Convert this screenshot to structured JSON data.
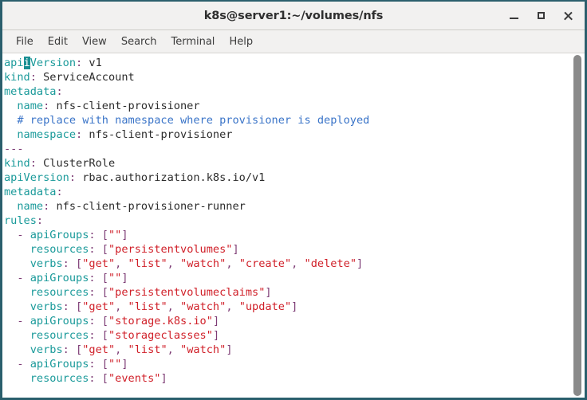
{
  "window": {
    "title": "k8s@server1:~/volumes/nfs",
    "buttons": {
      "minimize": "minimize",
      "maximize": "maximize",
      "close": "close"
    },
    "border_color": "#2b5f6d",
    "chrome_bg": "#f2f1f0"
  },
  "menubar": {
    "items": [
      {
        "label": "File"
      },
      {
        "label": "Edit"
      },
      {
        "label": "View"
      },
      {
        "label": "Search"
      },
      {
        "label": "Terminal"
      },
      {
        "label": "Help"
      }
    ]
  },
  "terminal": {
    "background": "#ffffff",
    "colors": {
      "key": "#1a9a9a",
      "value": "#2b2b2b",
      "comment": "#3a74c8",
      "punctuation": "#7d3c75",
      "string": "#d01f28",
      "cursor_bg": "#1a8f93",
      "cursor_fg": "#ffffff"
    },
    "cursor": {
      "line": 0,
      "column": 2,
      "char": "i"
    },
    "lines": [
      {
        "id": "l1",
        "tokens": [
          {
            "t": "api",
            "c": "k"
          },
          {
            "t": "i",
            "c": "cursor"
          },
          {
            "t": "Version",
            "c": "k"
          },
          {
            "t": ":",
            "c": "p"
          },
          {
            "t": " v1",
            "c": "v"
          }
        ]
      },
      {
        "id": "l2",
        "tokens": [
          {
            "t": "kind",
            "c": "k"
          },
          {
            "t": ":",
            "c": "p"
          },
          {
            "t": " ServiceAccount",
            "c": "v"
          }
        ]
      },
      {
        "id": "l3",
        "tokens": [
          {
            "t": "metadata",
            "c": "k"
          },
          {
            "t": ":",
            "c": "p"
          }
        ]
      },
      {
        "id": "l4",
        "tokens": [
          {
            "t": "  ",
            "c": "v"
          },
          {
            "t": "name",
            "c": "k"
          },
          {
            "t": ":",
            "c": "p"
          },
          {
            "t": " nfs-client-provisioner",
            "c": "v"
          }
        ]
      },
      {
        "id": "l5",
        "tokens": [
          {
            "t": "  ",
            "c": "v"
          },
          {
            "t": "# replace with namespace where provisioner is deployed",
            "c": "c"
          }
        ]
      },
      {
        "id": "l6",
        "tokens": [
          {
            "t": "  ",
            "c": "v"
          },
          {
            "t": "namespace",
            "c": "k"
          },
          {
            "t": ":",
            "c": "p"
          },
          {
            "t": " nfs-client-provisioner",
            "c": "v"
          }
        ]
      },
      {
        "id": "l7",
        "tokens": [
          {
            "t": "---",
            "c": "p"
          }
        ]
      },
      {
        "id": "l8",
        "tokens": [
          {
            "t": "kind",
            "c": "k"
          },
          {
            "t": ":",
            "c": "p"
          },
          {
            "t": " ClusterRole",
            "c": "v"
          }
        ]
      },
      {
        "id": "l9",
        "tokens": [
          {
            "t": "apiVersion",
            "c": "k"
          },
          {
            "t": ":",
            "c": "p"
          },
          {
            "t": " rbac.authorization.k8s.io/v1",
            "c": "v"
          }
        ]
      },
      {
        "id": "l10",
        "tokens": [
          {
            "t": "metadata",
            "c": "k"
          },
          {
            "t": ":",
            "c": "p"
          }
        ]
      },
      {
        "id": "l11",
        "tokens": [
          {
            "t": "  ",
            "c": "v"
          },
          {
            "t": "name",
            "c": "k"
          },
          {
            "t": ":",
            "c": "p"
          },
          {
            "t": " nfs-client-provisioner-runner",
            "c": "v"
          }
        ]
      },
      {
        "id": "l12",
        "tokens": [
          {
            "t": "rules",
            "c": "k"
          },
          {
            "t": ":",
            "c": "p"
          }
        ]
      },
      {
        "id": "l13",
        "tokens": [
          {
            "t": "  ",
            "c": "v"
          },
          {
            "t": "-",
            "c": "p"
          },
          {
            "t": " ",
            "c": "v"
          },
          {
            "t": "apiGroups",
            "c": "k"
          },
          {
            "t": ":",
            "c": "p"
          },
          {
            "t": " ",
            "c": "v"
          },
          {
            "t": "[",
            "c": "p"
          },
          {
            "t": "\"\"",
            "c": "s"
          },
          {
            "t": "]",
            "c": "p"
          }
        ]
      },
      {
        "id": "l14",
        "tokens": [
          {
            "t": "    ",
            "c": "v"
          },
          {
            "t": "resources",
            "c": "k"
          },
          {
            "t": ":",
            "c": "p"
          },
          {
            "t": " ",
            "c": "v"
          },
          {
            "t": "[",
            "c": "p"
          },
          {
            "t": "\"persistentvolumes\"",
            "c": "s"
          },
          {
            "t": "]",
            "c": "p"
          }
        ]
      },
      {
        "id": "l15",
        "tokens": [
          {
            "t": "    ",
            "c": "v"
          },
          {
            "t": "verbs",
            "c": "k"
          },
          {
            "t": ":",
            "c": "p"
          },
          {
            "t": " ",
            "c": "v"
          },
          {
            "t": "[",
            "c": "p"
          },
          {
            "t": "\"get\"",
            "c": "s"
          },
          {
            "t": ",",
            "c": "p"
          },
          {
            "t": " ",
            "c": "v"
          },
          {
            "t": "\"list\"",
            "c": "s"
          },
          {
            "t": ",",
            "c": "p"
          },
          {
            "t": " ",
            "c": "v"
          },
          {
            "t": "\"watch\"",
            "c": "s"
          },
          {
            "t": ",",
            "c": "p"
          },
          {
            "t": " ",
            "c": "v"
          },
          {
            "t": "\"create\"",
            "c": "s"
          },
          {
            "t": ",",
            "c": "p"
          },
          {
            "t": " ",
            "c": "v"
          },
          {
            "t": "\"delete\"",
            "c": "s"
          },
          {
            "t": "]",
            "c": "p"
          }
        ]
      },
      {
        "id": "l16",
        "tokens": [
          {
            "t": "  ",
            "c": "v"
          },
          {
            "t": "-",
            "c": "p"
          },
          {
            "t": " ",
            "c": "v"
          },
          {
            "t": "apiGroups",
            "c": "k"
          },
          {
            "t": ":",
            "c": "p"
          },
          {
            "t": " ",
            "c": "v"
          },
          {
            "t": "[",
            "c": "p"
          },
          {
            "t": "\"\"",
            "c": "s"
          },
          {
            "t": "]",
            "c": "p"
          }
        ]
      },
      {
        "id": "l17",
        "tokens": [
          {
            "t": "    ",
            "c": "v"
          },
          {
            "t": "resources",
            "c": "k"
          },
          {
            "t": ":",
            "c": "p"
          },
          {
            "t": " ",
            "c": "v"
          },
          {
            "t": "[",
            "c": "p"
          },
          {
            "t": "\"persistentvolumeclaims\"",
            "c": "s"
          },
          {
            "t": "]",
            "c": "p"
          }
        ]
      },
      {
        "id": "l18",
        "tokens": [
          {
            "t": "    ",
            "c": "v"
          },
          {
            "t": "verbs",
            "c": "k"
          },
          {
            "t": ":",
            "c": "p"
          },
          {
            "t": " ",
            "c": "v"
          },
          {
            "t": "[",
            "c": "p"
          },
          {
            "t": "\"get\"",
            "c": "s"
          },
          {
            "t": ",",
            "c": "p"
          },
          {
            "t": " ",
            "c": "v"
          },
          {
            "t": "\"list\"",
            "c": "s"
          },
          {
            "t": ",",
            "c": "p"
          },
          {
            "t": " ",
            "c": "v"
          },
          {
            "t": "\"watch\"",
            "c": "s"
          },
          {
            "t": ",",
            "c": "p"
          },
          {
            "t": " ",
            "c": "v"
          },
          {
            "t": "\"update\"",
            "c": "s"
          },
          {
            "t": "]",
            "c": "p"
          }
        ]
      },
      {
        "id": "l19",
        "tokens": [
          {
            "t": "  ",
            "c": "v"
          },
          {
            "t": "-",
            "c": "p"
          },
          {
            "t": " ",
            "c": "v"
          },
          {
            "t": "apiGroups",
            "c": "k"
          },
          {
            "t": ":",
            "c": "p"
          },
          {
            "t": " ",
            "c": "v"
          },
          {
            "t": "[",
            "c": "p"
          },
          {
            "t": "\"storage.k8s.io\"",
            "c": "s"
          },
          {
            "t": "]",
            "c": "p"
          }
        ]
      },
      {
        "id": "l20",
        "tokens": [
          {
            "t": "    ",
            "c": "v"
          },
          {
            "t": "resources",
            "c": "k"
          },
          {
            "t": ":",
            "c": "p"
          },
          {
            "t": " ",
            "c": "v"
          },
          {
            "t": "[",
            "c": "p"
          },
          {
            "t": "\"storageclasses\"",
            "c": "s"
          },
          {
            "t": "]",
            "c": "p"
          }
        ]
      },
      {
        "id": "l21",
        "tokens": [
          {
            "t": "    ",
            "c": "v"
          },
          {
            "t": "verbs",
            "c": "k"
          },
          {
            "t": ":",
            "c": "p"
          },
          {
            "t": " ",
            "c": "v"
          },
          {
            "t": "[",
            "c": "p"
          },
          {
            "t": "\"get\"",
            "c": "s"
          },
          {
            "t": ",",
            "c": "p"
          },
          {
            "t": " ",
            "c": "v"
          },
          {
            "t": "\"list\"",
            "c": "s"
          },
          {
            "t": ",",
            "c": "p"
          },
          {
            "t": " ",
            "c": "v"
          },
          {
            "t": "\"watch\"",
            "c": "s"
          },
          {
            "t": "]",
            "c": "p"
          }
        ]
      },
      {
        "id": "l22",
        "tokens": [
          {
            "t": "  ",
            "c": "v"
          },
          {
            "t": "-",
            "c": "p"
          },
          {
            "t": " ",
            "c": "v"
          },
          {
            "t": "apiGroups",
            "c": "k"
          },
          {
            "t": ":",
            "c": "p"
          },
          {
            "t": " ",
            "c": "v"
          },
          {
            "t": "[",
            "c": "p"
          },
          {
            "t": "\"\"",
            "c": "s"
          },
          {
            "t": "]",
            "c": "p"
          }
        ]
      },
      {
        "id": "l23",
        "tokens": [
          {
            "t": "    ",
            "c": "v"
          },
          {
            "t": "resources",
            "c": "k"
          },
          {
            "t": ":",
            "c": "p"
          },
          {
            "t": " ",
            "c": "v"
          },
          {
            "t": "[",
            "c": "p"
          },
          {
            "t": "\"events\"",
            "c": "s"
          },
          {
            "t": "]",
            "c": "p"
          }
        ]
      }
    ]
  },
  "scrollbar": {
    "orientation": "vertical",
    "thumb_color": "#8a8a8a"
  }
}
